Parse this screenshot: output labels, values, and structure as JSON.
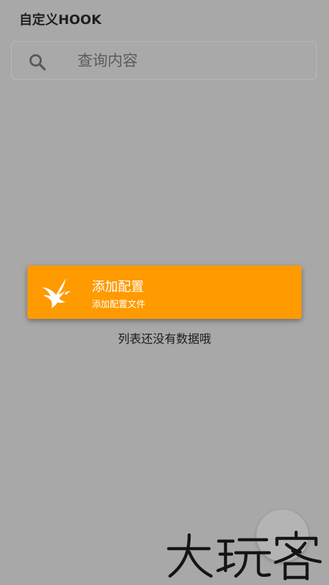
{
  "header": {
    "title": "自定义HOOK"
  },
  "search": {
    "placeholder": "查询内容",
    "icon": "search-icon"
  },
  "add_config_card": {
    "title": "添加配置",
    "subtitle": "添加配置文件",
    "icon": "eagle-icon",
    "background_color": "#ff9a00"
  },
  "empty_state": {
    "message": "列表还没有数据哦"
  },
  "fab": {
    "icon": "circle-button"
  },
  "watermark": {
    "text": "大玩客"
  },
  "colors": {
    "overlay_gray": "#a8a8a8",
    "accent_orange": "#ff9a00"
  }
}
